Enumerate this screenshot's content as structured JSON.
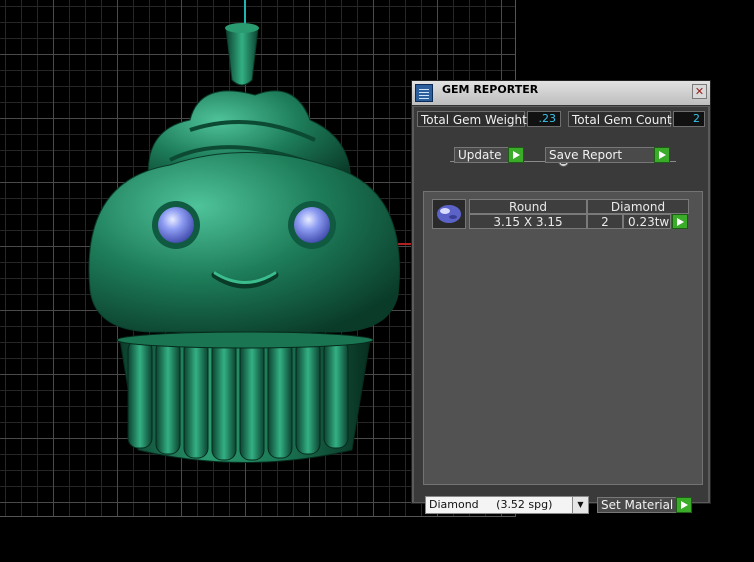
{
  "viewport": {
    "model_description": "cupcake-pendant"
  },
  "panel": {
    "title": "GEM REPORTER",
    "close_label": "✕",
    "total_weight_label": "Total Gem Weight",
    "total_weight_value": ".23",
    "total_count_label": "Total Gem Count",
    "total_count_value": "2",
    "update_label": "Update",
    "save_report_label": "Save Report",
    "gem_row": {
      "shape": "Round",
      "material": "Diamond",
      "size": "3.15 X 3.15",
      "count": "2",
      "weight": "0.23tw"
    },
    "material_select": "Diamond     (3.52 spg)",
    "set_material_label": "Set Material"
  },
  "colors": {
    "model_green": "#1e7a5a",
    "gem_blue": "#7f8ff0",
    "value_cyan": "#38c3e8",
    "go_green": "#3bab2a"
  }
}
